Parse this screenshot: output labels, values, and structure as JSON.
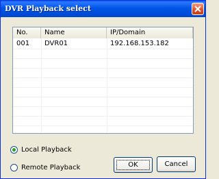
{
  "window": {
    "title": "DVR Playback select"
  },
  "table": {
    "columns": [
      "No.",
      "Name",
      "IP/Domain"
    ],
    "rows": [
      {
        "no": "001",
        "name": "DVR01",
        "ip": "192.168.153.182"
      }
    ]
  },
  "options": {
    "local_label": "Local Playback",
    "remote_label": "Remote Playback",
    "selected": "local"
  },
  "buttons": {
    "ok_label": "OK",
    "cancel_label": "Cancel"
  },
  "colors": {
    "titlebar": "#0055e5",
    "close": "#e14e25",
    "radio_dot": "#21a121"
  }
}
